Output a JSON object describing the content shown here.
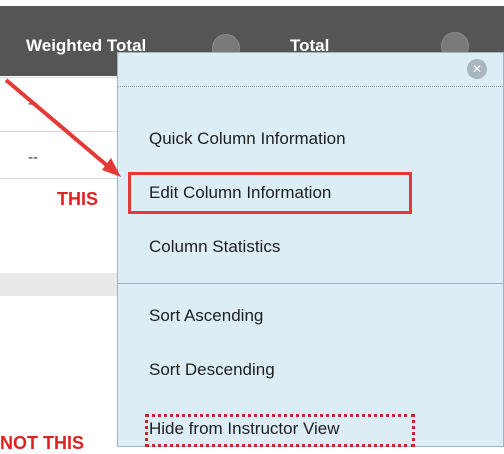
{
  "header": {
    "weighted_total_label": "Weighted Total",
    "total_label": "Total",
    "bg_color": "#555555"
  },
  "grid": {
    "cells": [
      "--",
      "--"
    ]
  },
  "menu": {
    "bg_color": "#ddedf5",
    "items": [
      {
        "label": "Quick Column Information"
      },
      {
        "label": "Edit Column Information"
      },
      {
        "label": "Column Statistics"
      },
      {
        "label": "Sort Ascending"
      },
      {
        "label": "Sort Descending"
      },
      {
        "label": "Hide from Instructor View"
      }
    ],
    "close_icon": "close-icon"
  },
  "annotations": {
    "this_label": "THIS",
    "not_this_label": "NOT THIS",
    "highlight_color": "#e53935"
  }
}
